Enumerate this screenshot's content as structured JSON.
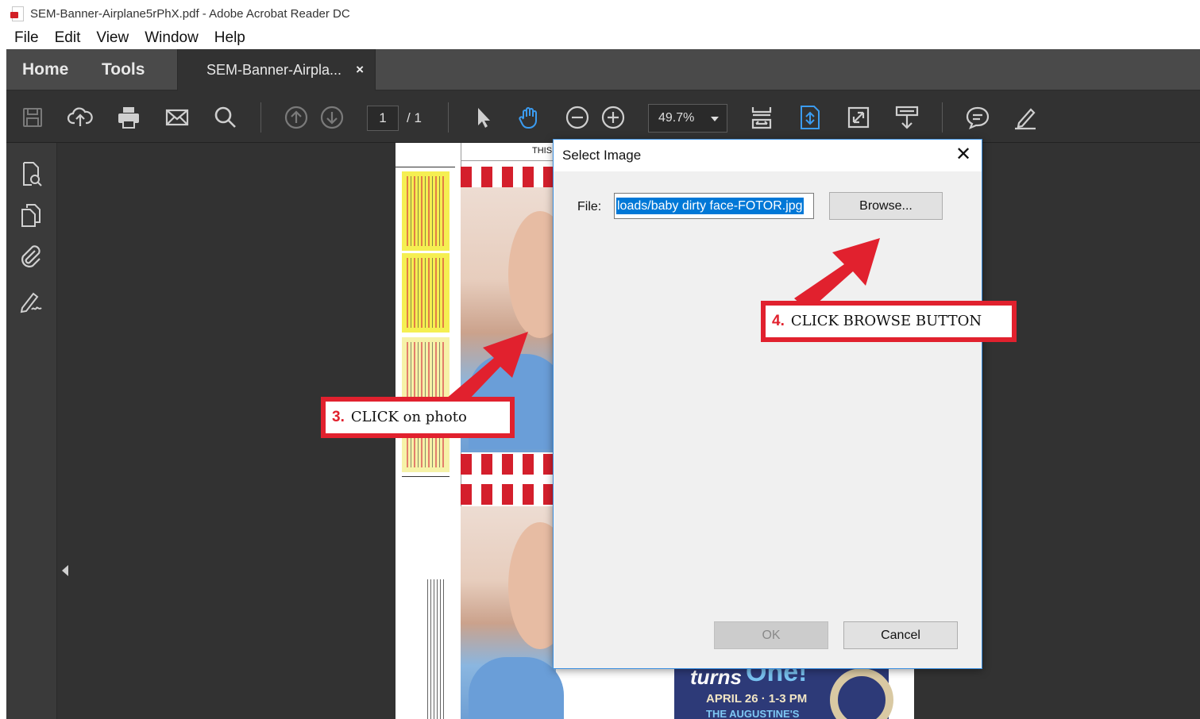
{
  "window": {
    "title": "SEM-Banner-Airplane5rPhX.pdf - Adobe Acrobat Reader DC"
  },
  "menu": [
    "File",
    "Edit",
    "View",
    "Window",
    "Help"
  ],
  "tabs": {
    "home": "Home",
    "tools": "Tools",
    "document": "SEM-Banner-Airpla...",
    "close": "×"
  },
  "toolbar": {
    "page_current": "1",
    "page_total": "/ 1",
    "zoom": "49.7%"
  },
  "document": {
    "header_fragment": "THIS",
    "invite_turns": "turns",
    "invite_one": "One!",
    "invite_date": "APRIL 26 · 1-3 PM",
    "invite_place": "THE AUGUSTINE'S"
  },
  "dialog": {
    "title": "Select Image",
    "close": "✕",
    "file_label": "File:",
    "file_value": "loads/baby dirty face-FOTOR.jpg",
    "browse_label": "Browse...",
    "ok_label": "OK",
    "cancel_label": "Cancel"
  },
  "annotations": {
    "step3_number": "3.",
    "step3_text": "CLICK on photo",
    "step4_number": "4.",
    "step4_text": "CLICK BROWSE BUTTON"
  },
  "colors": {
    "annotation_red": "#e1212e",
    "app_dark": "#323232",
    "highlight": "#0078d7",
    "active_tool_blue": "#3b9cf1"
  }
}
